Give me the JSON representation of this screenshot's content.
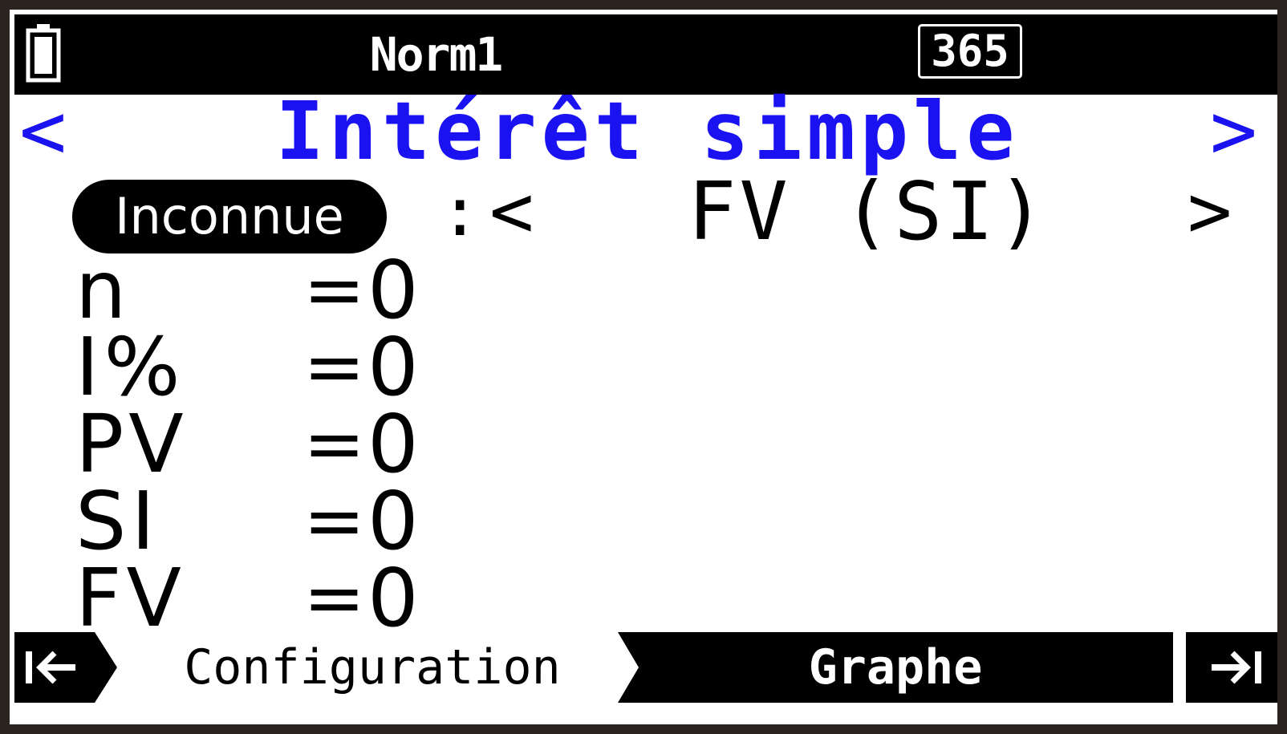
{
  "statusbar": {
    "mode": "Norm1",
    "days": "365",
    "battery_icon": "battery-icon"
  },
  "title": {
    "text": "Intérêt simple",
    "prev_arrow": "<",
    "next_arrow": ">",
    "color": "#1a12f0"
  },
  "unknown": {
    "label": "Inconnue",
    "separator": ":",
    "prev_arrow": "<",
    "value": "FV (SI)",
    "next_arrow": ">"
  },
  "variables": [
    {
      "name": "n",
      "eq": "=",
      "value": "0"
    },
    {
      "name": "I%",
      "eq": "=",
      "value": "0"
    },
    {
      "name": "PV",
      "eq": "=",
      "value": "0"
    },
    {
      "name": "SI",
      "eq": "=",
      "value": "0"
    },
    {
      "name": "FV",
      "eq": "=",
      "value": "0"
    }
  ],
  "bottombar": {
    "left_icon": "jump-left-icon",
    "tab_config": "Configuration",
    "tab_graph": "Graphe",
    "right_icon": "jump-right-icon"
  }
}
